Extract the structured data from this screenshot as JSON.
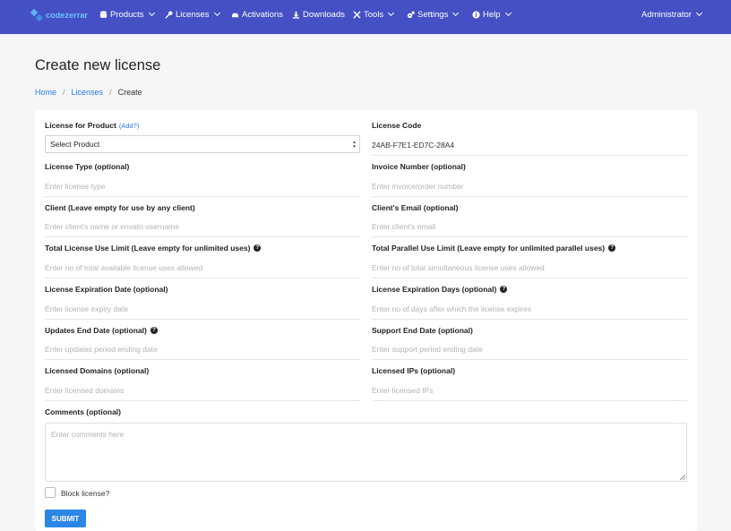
{
  "colors": {
    "navbar": "#4450c4",
    "link": "#2c7be5",
    "submit": "#2c86e5"
  },
  "nav": {
    "brand": "codezerrar",
    "items": [
      {
        "label": "Products",
        "icon": "database-icon"
      },
      {
        "label": "Licenses",
        "icon": "key-icon"
      },
      {
        "label": "Activations",
        "icon": "car-icon"
      },
      {
        "label": "Downloads",
        "icon": "download-icon"
      },
      {
        "label": "Tools",
        "icon": "tools-icon"
      },
      {
        "label": "Settings",
        "icon": "gears-icon"
      },
      {
        "label": "Help",
        "icon": "info-circle-icon"
      }
    ],
    "user": "Administrator"
  },
  "page": {
    "title": "Create new license",
    "breadcrumb": {
      "home": "Home",
      "licenses": "Licenses",
      "current": "Create",
      "sep": "/"
    }
  },
  "form": {
    "product": {
      "label": "License for Product",
      "add": "(Add?)",
      "value": "Select Product"
    },
    "code": {
      "label": "License Code",
      "value": "24AB-F7E1-ED7C-28A4"
    },
    "type": {
      "label": "License Type (optional)",
      "placeholder": "Enter license type"
    },
    "invoice": {
      "label": "Invoice Number (optional)",
      "placeholder": "Enter invoice/order number"
    },
    "client": {
      "label": "Client (Leave empty for use by any client)",
      "placeholder": "Enter client's name or envato username"
    },
    "email": {
      "label": "Client's Email (optional)",
      "placeholder": "Enter client's email"
    },
    "use_limit": {
      "label": "Total License Use Limit (Leave empty for unlimited uses)",
      "placeholder": "Enter no of total available license uses allowed"
    },
    "parallel_limit": {
      "label": "Total Parallel Use Limit (Leave empty for unlimited parallel uses)",
      "placeholder": "Enter no of total simultaneous license uses allowed"
    },
    "expiry_date": {
      "label": "License Expiration Date (optional)",
      "placeholder": "Enter license expiry date"
    },
    "expiry_days": {
      "label": "License Expiration Days (optional)",
      "placeholder": "Enter no of days after which the license expires"
    },
    "updates_end": {
      "label": "Updates End Date (optional)",
      "placeholder": "Enter updates period ending date"
    },
    "support_end": {
      "label": "Support End Date (optional)",
      "placeholder": "Enter support period ending date"
    },
    "domains": {
      "label": "Licensed Domains (optional)",
      "placeholder": "Enter licensed domains"
    },
    "ips": {
      "label": "Licensed IPs (optional)",
      "placeholder": "Enter licensed IPs"
    },
    "comments": {
      "label": "Comments (optional)",
      "placeholder": "Enter comments here"
    },
    "block": {
      "label": "Block license?"
    },
    "submit": "SUBMIT",
    "help_mark": "?"
  }
}
